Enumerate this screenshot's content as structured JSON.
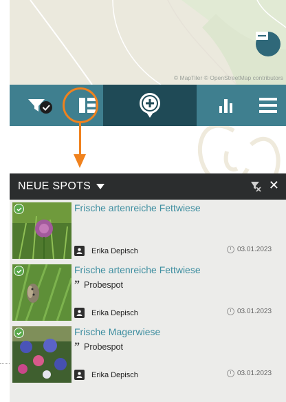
{
  "map": {
    "attribution": "© MapTiler © OpenStreetMap contributors",
    "fab_icon": "list-view-icon"
  },
  "toolbar": {
    "items": [
      {
        "icon": "filter-check-icon"
      },
      {
        "icon": "list-icon",
        "highlighted": true
      },
      {
        "icon": "add-location-icon"
      },
      {
        "icon": "bar-chart-icon"
      },
      {
        "icon": "menu-icon"
      }
    ]
  },
  "panel": {
    "title": "NEUE SPOTS",
    "filter_icon": "filter-clear-icon",
    "close_label": "✕"
  },
  "spots": [
    {
      "title": "Frische artenreiche Fettwiese",
      "quote": "",
      "author": "Erika Depisch",
      "date": "03.01.2023"
    },
    {
      "title": "Frische artenreiche Fettwiese",
      "quote": "Probespot",
      "author": "Erika Depisch",
      "date": "03.01.2023"
    },
    {
      "title": "Frische Magerwiese",
      "quote": "Probespot",
      "author": "Erika Depisch",
      "date": "03.01.2023"
    }
  ],
  "colors": {
    "toolbar": "#3f7f8f",
    "toolbar_center": "#1f4a56",
    "accent": "#f0821e",
    "title_link": "#3e8ea0",
    "panel_header": "#2b2d2e"
  }
}
